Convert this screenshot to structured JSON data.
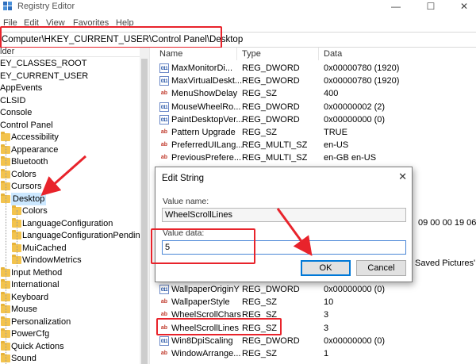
{
  "window": {
    "title": "Registry Editor",
    "minimize": "—",
    "maximize": "☐",
    "close": "✕"
  },
  "menu": [
    "File",
    "Edit",
    "View",
    "Favorites",
    "Help"
  ],
  "address": "Computer\\HKEY_CURRENT_USER\\Control Panel\\Desktop",
  "tree": {
    "header": "lder",
    "items": [
      {
        "label": "EY_CLASSES_ROOT",
        "folder": false
      },
      {
        "label": "EY_CURRENT_USER",
        "folder": false
      },
      {
        "label": "AppEvents",
        "folder": false
      },
      {
        "label": "CLSID",
        "folder": false
      },
      {
        "label": "Console",
        "folder": false
      },
      {
        "label": "Control Panel",
        "folder": false
      },
      {
        "label": "Accessibility",
        "folder": true
      },
      {
        "label": "Appearance",
        "folder": true
      },
      {
        "label": "Bluetooth",
        "folder": true
      },
      {
        "label": "Colors",
        "folder": true
      },
      {
        "label": "Cursors",
        "folder": true
      },
      {
        "label": "Desktop",
        "folder": true
      },
      {
        "label": "Colors",
        "folder": true
      },
      {
        "label": "LanguageConfiguration",
        "folder": true
      },
      {
        "label": "LanguageConfigurationPending",
        "folder": true
      },
      {
        "label": "MuiCached",
        "folder": true
      },
      {
        "label": "WindowMetrics",
        "folder": true
      },
      {
        "label": "Input Method",
        "folder": true
      },
      {
        "label": "International",
        "folder": true
      },
      {
        "label": "Keyboard",
        "folder": true
      },
      {
        "label": "Mouse",
        "folder": true
      },
      {
        "label": "Personalization",
        "folder": true
      },
      {
        "label": "PowerCfg",
        "folder": true
      },
      {
        "label": "Quick Actions",
        "folder": true
      },
      {
        "label": "Sound",
        "folder": true
      }
    ]
  },
  "list": {
    "columns": [
      "Name",
      "Type",
      "Data"
    ],
    "rows_top": [
      {
        "icon": "bin",
        "name": "MaxMonitorDi...",
        "type": "REG_DWORD",
        "data": "0x00000780 (1920)"
      },
      {
        "icon": "bin",
        "name": "MaxVirtualDeskt...",
        "type": "REG_DWORD",
        "data": "0x00000780 (1920)"
      },
      {
        "icon": "sz",
        "name": "MenuShowDelay",
        "type": "REG_SZ",
        "data": "400"
      },
      {
        "icon": "bin",
        "name": "MouseWheelRo...",
        "type": "REG_DWORD",
        "data": "0x00000002 (2)"
      },
      {
        "icon": "bin",
        "name": "PaintDesktopVer...",
        "type": "REG_DWORD",
        "data": "0x00000000 (0)"
      },
      {
        "icon": "sz",
        "name": "Pattern Upgrade",
        "type": "REG_SZ",
        "data": "TRUE"
      },
      {
        "icon": "sz",
        "name": "PreferredUILang...",
        "type": "REG_MULTI_SZ",
        "data": "en-US"
      },
      {
        "icon": "sz",
        "name": "PreviousPrefere...",
        "type": "REG_MULTI_SZ",
        "data": "en-GB en-US"
      }
    ],
    "partial_right": [
      {
        "text": "09 00 00 19 06"
      },
      {
        "text": "Saved Pictures'"
      }
    ],
    "rows_bottom": [
      {
        "icon": "bin",
        "name": "WallpaperOriginY",
        "type": "REG_DWORD",
        "data": "0x00000000 (0)"
      },
      {
        "icon": "sz",
        "name": "WallpaperStyle",
        "type": "REG_SZ",
        "data": "10"
      },
      {
        "icon": "sz",
        "name": "WheelScrollChars",
        "type": "REG_SZ",
        "data": "3"
      },
      {
        "icon": "sz",
        "name": "WheelScrollLines",
        "type": "REG_SZ",
        "data": "3"
      },
      {
        "icon": "bin",
        "name": "Win8DpiScaling",
        "type": "REG_DWORD",
        "data": "0x00000000 (0)"
      },
      {
        "icon": "sz",
        "name": "WindowArrange...",
        "type": "REG_SZ",
        "data": "1"
      }
    ]
  },
  "dialog": {
    "title": "Edit String",
    "close": "✕",
    "value_name_label": "Value name:",
    "value_name": "WheelScrollLines",
    "value_data_label": "Value data:",
    "value_data": "5",
    "ok_label": "OK",
    "cancel_label": "Cancel"
  },
  "colors": {
    "highlight": "#e8232b",
    "selection": "#cce8ff",
    "folder": "#f3c34d",
    "accent": "#0078d7"
  }
}
